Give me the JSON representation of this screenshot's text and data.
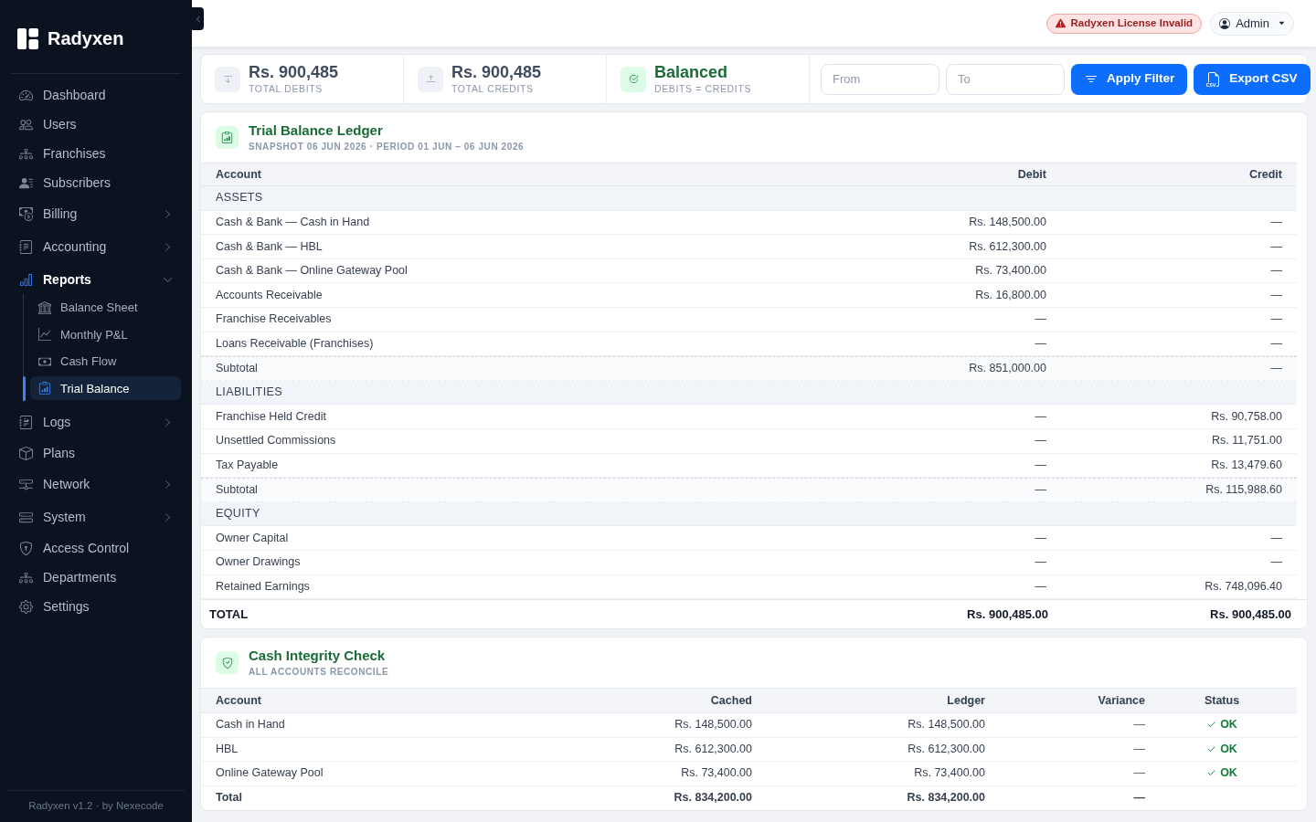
{
  "sidebar": {
    "brand": "Radyxen",
    "items": [
      {
        "label": "Dashboard",
        "kind": "link",
        "selected": false
      },
      {
        "label": "Users",
        "kind": "link",
        "selected": false
      },
      {
        "label": "Franchises",
        "kind": "link",
        "selected": false
      },
      {
        "label": "Subscribers",
        "kind": "link",
        "selected": false
      },
      {
        "label": "Billing",
        "kind": "group",
        "selected": false,
        "expanded": false
      },
      {
        "label": "Accounting",
        "kind": "group",
        "selected": false,
        "expanded": false
      },
      {
        "label": "Reports",
        "kind": "group",
        "selected": true,
        "expanded": true,
        "children": [
          {
            "label": "Balance Sheet",
            "selected": false
          },
          {
            "label": "Monthly P&L",
            "selected": false
          },
          {
            "label": "Cash Flow",
            "selected": false
          },
          {
            "label": "Trial Balance",
            "selected": true
          }
        ]
      },
      {
        "label": "Logs",
        "kind": "group",
        "selected": false,
        "expanded": false
      },
      {
        "label": "Plans",
        "kind": "link",
        "selected": false
      },
      {
        "label": "Network",
        "kind": "group",
        "selected": false,
        "expanded": false
      },
      {
        "label": "System",
        "kind": "group",
        "selected": false,
        "expanded": false
      },
      {
        "label": "Access Control",
        "kind": "link",
        "selected": false
      },
      {
        "label": "Departments",
        "kind": "link",
        "selected": false
      },
      {
        "label": "Settings",
        "kind": "link",
        "selected": false
      }
    ],
    "footer": "Radyxen v1.2 · by Nexecode"
  },
  "top_bar": {
    "license_alert": "Radyxen License Invalid",
    "user_menu": "Admin"
  },
  "summary": {
    "stats": [
      {
        "kind": "debit",
        "value": "Rs. 900,485",
        "label": "TOTAL DEBITS"
      },
      {
        "kind": "credit",
        "value": "Rs. 900,485",
        "label": "TOTAL CREDITS"
      },
      {
        "kind": "balanced",
        "value": "Balanced",
        "label": "DEBITS = CREDITS"
      }
    ],
    "filters": {
      "from": {
        "placeholder": "From"
      },
      "to": {
        "placeholder": "To"
      },
      "buttons": [
        {
          "kind": "filter",
          "label": "Apply Filter"
        },
        {
          "kind": "export",
          "label": "Export CSV"
        }
      ]
    }
  },
  "ledger": {
    "title": "Trial Balance Ledger",
    "subtitle": "SNAPSHOT 06 JUN 2026 · PERIOD 01 JUN – 06 JUN 2026",
    "columns": [
      "Account",
      "Debit",
      "Credit"
    ],
    "rows": [
      {
        "kind": "section",
        "account": "ASSETS"
      },
      {
        "kind": "line",
        "account": "Cash & Bank — Cash in Hand",
        "debit": "Rs. 148,500.00",
        "credit": "—"
      },
      {
        "kind": "line",
        "account": "Cash & Bank — HBL",
        "debit": "Rs. 612,300.00",
        "credit": "—"
      },
      {
        "kind": "line",
        "account": "Cash & Bank — Online Gateway Pool",
        "debit": "Rs. 73,400.00",
        "credit": "—"
      },
      {
        "kind": "line",
        "account": "Accounts Receivable",
        "debit": "Rs. 16,800.00",
        "credit": "—"
      },
      {
        "kind": "line",
        "account": "Franchise Receivables",
        "debit": "—",
        "credit": "—"
      },
      {
        "kind": "line",
        "account": "Loans Receivable (Franchises)",
        "debit": "—",
        "credit": "—"
      },
      {
        "kind": "subtotal",
        "account": "Subtotal",
        "debit": "Rs. 851,000.00",
        "credit": "—"
      },
      {
        "kind": "section",
        "account": "LIABILITIES"
      },
      {
        "kind": "line",
        "account": "Franchise Held Credit",
        "debit": "—",
        "credit": "Rs. 90,758.00"
      },
      {
        "kind": "line",
        "account": "Unsettled Commissions",
        "debit": "—",
        "credit": "Rs. 11,751.00"
      },
      {
        "kind": "line",
        "account": "Tax Payable",
        "debit": "—",
        "credit": "Rs. 13,479.60"
      },
      {
        "kind": "subtotal",
        "account": "Subtotal",
        "debit": "—",
        "credit": "Rs. 115,988.60"
      },
      {
        "kind": "section",
        "account": "EQUITY"
      },
      {
        "kind": "line",
        "account": "Owner Capital",
        "debit": "—",
        "credit": "—"
      },
      {
        "kind": "line",
        "account": "Owner Drawings",
        "debit": "—",
        "credit": "—"
      },
      {
        "kind": "line",
        "account": "Retained Earnings",
        "debit": "—",
        "credit": "Rs. 748,096.40"
      }
    ],
    "total": {
      "label": "TOTAL",
      "debit": "Rs. 900,485.00",
      "credit": "Rs. 900,485.00"
    }
  },
  "cash_integrity": {
    "title": "Cash Integrity Check",
    "subtitle": "ALL ACCOUNTS RECONCILE",
    "columns": [
      "Account",
      "Cached",
      "Ledger",
      "Variance",
      "Status"
    ],
    "rows": [
      {
        "account": "Cash in Hand",
        "cached": "Rs. 148,500.00",
        "ledger": "Rs. 148,500.00",
        "variance": "—",
        "status": "OK",
        "ok": true
      },
      {
        "account": "HBL",
        "cached": "Rs. 612,300.00",
        "ledger": "Rs. 612,300.00",
        "variance": "—",
        "status": "OK",
        "ok": true
      },
      {
        "account": "Online Gateway Pool",
        "cached": "Rs. 73,400.00",
        "ledger": "Rs. 73,400.00",
        "variance": "—",
        "status": "OK",
        "ok": true
      }
    ],
    "total": {
      "label": "Total",
      "cached": "Rs. 834,200.00",
      "ledger": "Rs. 834,200.00",
      "variance": "—"
    }
  }
}
